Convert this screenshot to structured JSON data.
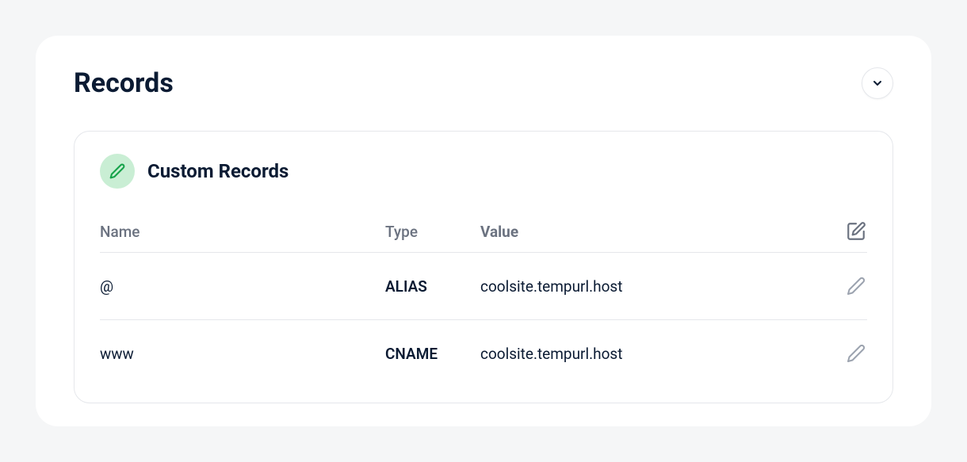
{
  "card": {
    "title": "Records"
  },
  "panel": {
    "title": "Custom Records",
    "columns": {
      "name": "Name",
      "type": "Type",
      "value": "Value"
    },
    "rows": [
      {
        "name": "@",
        "type": "ALIAS",
        "value": "coolsite.tempurl.host"
      },
      {
        "name": "www",
        "type": "CNAME",
        "value": "coolsite.tempurl.host"
      }
    ]
  }
}
